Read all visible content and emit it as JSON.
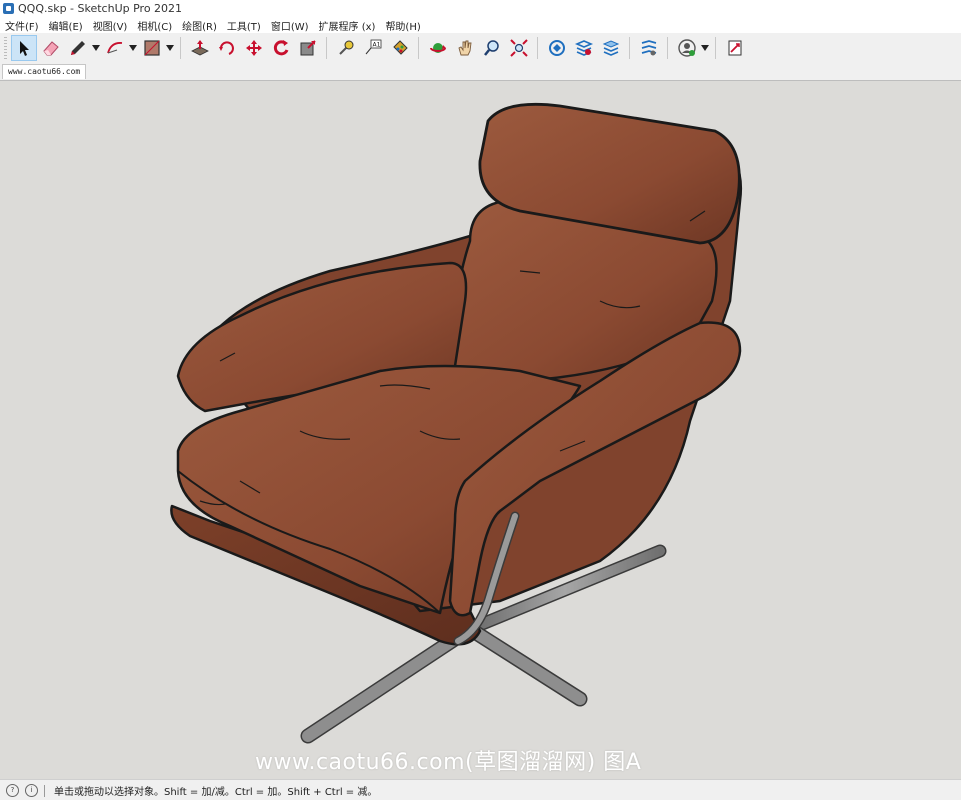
{
  "window": {
    "title": "QQQ.skp - SketchUp Pro 2021"
  },
  "menu": [
    {
      "label": "文件(F)"
    },
    {
      "label": "编辑(E)"
    },
    {
      "label": "视图(V)"
    },
    {
      "label": "相机(C)"
    },
    {
      "label": "绘图(R)"
    },
    {
      "label": "工具(T)"
    },
    {
      "label": "窗口(W)"
    },
    {
      "label": "扩展程序 (x)"
    },
    {
      "label": "帮助(H)"
    }
  ],
  "toolbar": {
    "tools": [
      {
        "icon": "select-arrow-icon",
        "active": true
      },
      {
        "icon": "eraser-icon"
      },
      {
        "icon": "pencil-line-icon"
      },
      {
        "icon": "arc-icon"
      },
      {
        "icon": "rectangle-icon"
      },
      {
        "icon": "push-pull-icon"
      },
      {
        "icon": "rotate-icon"
      },
      {
        "icon": "move-icon"
      },
      {
        "icon": "follow-me-icon"
      },
      {
        "icon": "scale-icon"
      },
      {
        "icon": "tape-measure-icon"
      },
      {
        "icon": "text-label-icon"
      },
      {
        "icon": "paint-bucket-icon"
      },
      {
        "icon": "orbit-icon"
      },
      {
        "icon": "pan-hand-icon"
      },
      {
        "icon": "zoom-icon"
      },
      {
        "icon": "zoom-extents-icon"
      },
      {
        "icon": "warehouse-icon"
      },
      {
        "icon": "extension-warehouse-icon"
      },
      {
        "icon": "layout-icon"
      },
      {
        "icon": "extension-manager-icon"
      },
      {
        "icon": "profile-icon"
      },
      {
        "icon": "send-to-layout-icon"
      }
    ],
    "colors": {
      "active_bg": "#cce4f7",
      "accent_red": "#c8102e",
      "accent_blue": "#1f6fbf"
    }
  },
  "scene_tab": {
    "label": "www.caotu66.com"
  },
  "viewport": {
    "background": "#dcdbd8",
    "model_colors": {
      "leather": "#8b4a32",
      "leather_light": "#9c5a3e",
      "leather_dark": "#6e3724",
      "edge": "#1a1a1a",
      "metal": "#8e8e8e"
    },
    "watermark": "www.caotu66.com(草图溜溜网) 图A"
  },
  "status": {
    "text": "单击或拖动以选择对象。Shift = 加/减。Ctrl = 加。Shift + Ctrl = 减。"
  }
}
